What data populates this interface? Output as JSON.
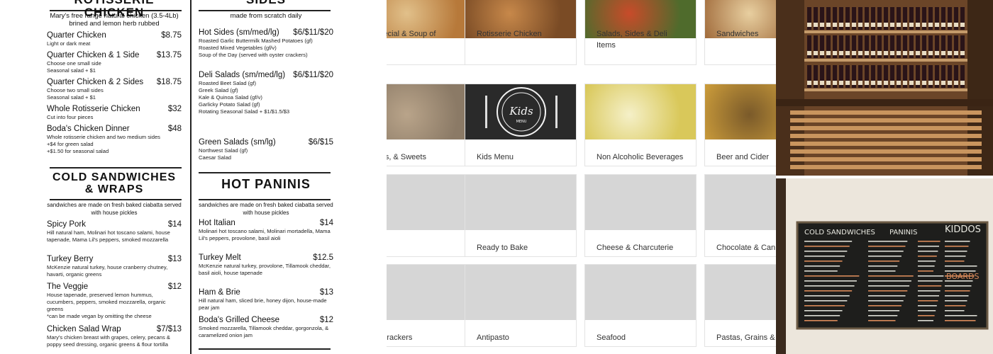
{
  "menu": {
    "rotisserie": {
      "title": "ROTISSERIE CHICKEN",
      "subtitle": "Mary's free range natural chicken (3.5-4Lb) brined and lemon herb rubbed",
      "items": [
        {
          "name": "Quarter Chicken",
          "price": "$8.75",
          "desc": "Light or dark meat"
        },
        {
          "name": "Quarter Chicken & 1 Side",
          "price": "$13.75",
          "desc": "Choose one small side\nSeasonal salad + $1"
        },
        {
          "name": "Quarter Chicken & 2 Sides",
          "price": "$18.75",
          "desc": "Choose two small sides\nSeasonal salad + $1"
        },
        {
          "name": "Whole Rotisserie Chicken",
          "price": "$32",
          "desc": "Cut into four pieces"
        },
        {
          "name": "Boda's Chicken Dinner",
          "price": "$48",
          "desc": "Whole rotisserie chicken and two medium sides\n+$4 for green salad\n+$1.50 for seasonal salad"
        }
      ]
    },
    "sides": {
      "title": "SIDES",
      "subtitle": "made from scratch daily",
      "items": [
        {
          "name": "Hot Sides (sm/med/lg)",
          "price": "$6/$11/$20",
          "desc": "Roasted Garlic Buttermilk Mashed Potatoes (gf)\nRoasted Mixed Vegetables (gf/v)\nSoup of the Day (served with oyster crackers)"
        },
        {
          "name": "Deli Salads (sm/med/lg)",
          "price": "$6/$11/$20",
          "desc": "Roasted Beet Salad (gf)\nGreek Salad (gf)\nKale & Quinoa Salad (gf/v)\nGarlicky Potato Salad (gf)\nRotating Seasonal Salad + $1/$1.5/$3"
        },
        {
          "name": "Green Salads (sm/lg)",
          "price": "$6/$15",
          "desc": "Northwest Salad (gf)\nCaesar Salad"
        }
      ]
    },
    "cold_sandwiches": {
      "title": "COLD SANDWICHES & WRAPS",
      "subtitle": "sandwiches are made on fresh baked ciabatta served with house pickles",
      "items": [
        {
          "name": "Spicy Pork",
          "price": "$14",
          "desc": "Hill natural ham, Molinari hot toscano salami, house tapenade, Mama Lil's peppers, smoked mozzarella"
        },
        {
          "name": "Turkey Berry",
          "price": "$13",
          "desc": "McKenzie natural turkey, house cranberry chutney, havarti, organic greens"
        },
        {
          "name": "The Veggie",
          "price": "$12",
          "desc": "House tapenade, preserved lemon hummus, cucumbers, peppers, smoked mozzarella, organic greens\n*can be made vegan by omitting the cheese"
        },
        {
          "name": "Chicken Salad Wrap",
          "price": "$7/$13",
          "desc": "Mary's chicken breast with grapes, celery, pecans & poppy seed dressing, organic greens & flour tortilla"
        }
      ]
    },
    "hot_paninis": {
      "title": "HOT PANINIS",
      "subtitle": "sandwiches are made on fresh baked ciabatta served with house pickles",
      "items": [
        {
          "name": "Hot Italian",
          "price": "$14",
          "desc": "Molinari hot toscano salami, Molinari mortadella, Mama Lil's peppers, provolone, basil aioli"
        },
        {
          "name": "Turkey Melt",
          "price": "$12.5",
          "desc": "McKenzie natural turkey, provolone, Tillamook cheddar, basil aioli, house tapenade"
        },
        {
          "name": "Ham & Brie",
          "price": "$13",
          "desc": "Hill natural ham, sliced brie, honey dijon, house-made pear jam"
        },
        {
          "name": "Boda's Grilled Cheese",
          "price": "$12",
          "desc": "Smoked mozzarella, Tillamook cheddar, gorgonzola, & caramelized onion jam"
        }
      ]
    }
  },
  "categories": [
    {
      "label": "Special & Soup of",
      "image": "food-plate"
    },
    {
      "label": "Rotisserie Chicken",
      "image": "chicken"
    },
    {
      "label": "Salads, Sides & Deli Items",
      "image": "salad"
    },
    {
      "label": "Sandwiches",
      "image": "sandwich"
    },
    {
      "label": "Pies, & Sweets",
      "image": "cookies"
    },
    {
      "label": "Kids Menu",
      "image": "kids-plate"
    },
    {
      "label": "Non Alcoholic Beverages",
      "image": "lemonade"
    },
    {
      "label": "Beer and Cider",
      "image": "beer"
    },
    {
      "label": "",
      "image": "placeholder"
    },
    {
      "label": "Ready to Bake",
      "image": "placeholder"
    },
    {
      "label": "Cheese & Charcuterie",
      "image": "placeholder"
    },
    {
      "label": "Chocolate & Can",
      "image": "placeholder"
    },
    {
      "label": "& Crackers",
      "image": "placeholder"
    },
    {
      "label": "Antipasto",
      "image": "placeholder"
    },
    {
      "label": "Seafood",
      "image": "placeholder"
    },
    {
      "label": "Pastas, Grains &",
      "image": "placeholder"
    }
  ],
  "kids_image_text": {
    "title": "Kids",
    "sub": "MENU"
  },
  "chalkboard": {
    "headings": [
      "COLD SANDWICHES",
      "PANINIS",
      "KIDDOS"
    ],
    "sub": "BOARDS"
  },
  "colors": {
    "menu_rule": "#222222",
    "card_border": "#e3e3e3",
    "placeholder": "#d6d6d6",
    "label_text": "#333333"
  }
}
